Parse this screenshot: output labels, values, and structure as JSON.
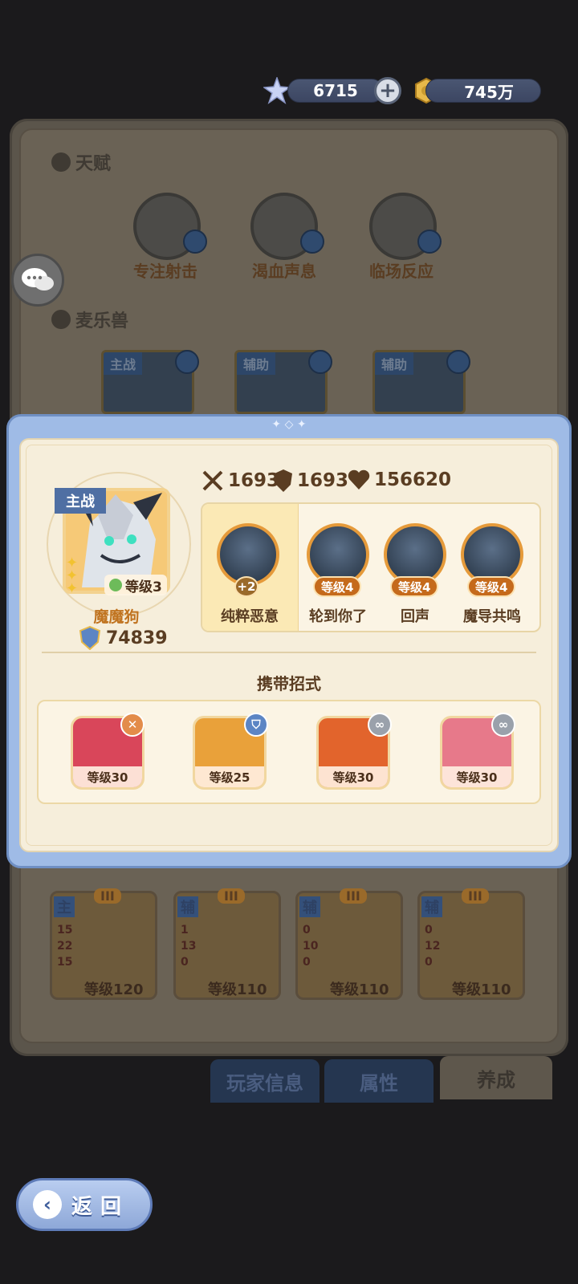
{
  "currency": {
    "gems": "6715",
    "gold": "745万"
  },
  "background": {
    "talent_title": "天赋",
    "talents": [
      {
        "label": "专注射击",
        "icon": "bow-icon"
      },
      {
        "label": "渴血声息",
        "icon": "blood-drop-icon"
      },
      {
        "label": "临场反应",
        "icon": "triangle-rune-icon"
      }
    ],
    "pets_title": "麦乐兽",
    "pet_cards": [
      {
        "tag": "主战"
      },
      {
        "tag": "辅助"
      },
      {
        "tag": "辅助"
      }
    ],
    "team": [
      {
        "tag": "主",
        "rank": "III",
        "stats": [
          "15",
          "22",
          "15"
        ],
        "level": "等级120"
      },
      {
        "tag": "辅",
        "rank": "III",
        "stats": [
          "1",
          "13",
          "0"
        ],
        "level": "等级110"
      },
      {
        "tag": "辅",
        "rank": "III",
        "stats": [
          "0",
          "10",
          "0"
        ],
        "level": "等级110"
      },
      {
        "tag": "辅",
        "rank": "III",
        "stats": [
          "0",
          "12",
          "0"
        ],
        "level": "等级110"
      }
    ],
    "tabs": [
      "玩家信息",
      "属性",
      "养成"
    ]
  },
  "modal": {
    "role_tag": "主战",
    "pet_level": "等级3",
    "pet_name": "魔魔狗",
    "power": "74839",
    "stats": {
      "attack": "1693",
      "defense": "1693",
      "hp": "156620"
    },
    "skills": [
      {
        "name": "纯粹恶意",
        "level": "+2",
        "highlight": true
      },
      {
        "name": "轮到你了",
        "level": "等级4"
      },
      {
        "name": "回声",
        "level": "等级4"
      },
      {
        "name": "魔导共鸣",
        "level": "等级4"
      }
    ],
    "moves_title": "携带招式",
    "moves": [
      {
        "level": "等级30",
        "badge": "crossed-swords-icon",
        "color": "#d9465a"
      },
      {
        "level": "等级25",
        "badge": "shield-icon",
        "color": "#e9a13a"
      },
      {
        "level": "等级30",
        "badge": "link-icon",
        "color": "#e2642c"
      },
      {
        "level": "等级30",
        "badge": "link-icon",
        "color": "#e7798a"
      }
    ]
  },
  "back_button": {
    "label": "返回"
  }
}
